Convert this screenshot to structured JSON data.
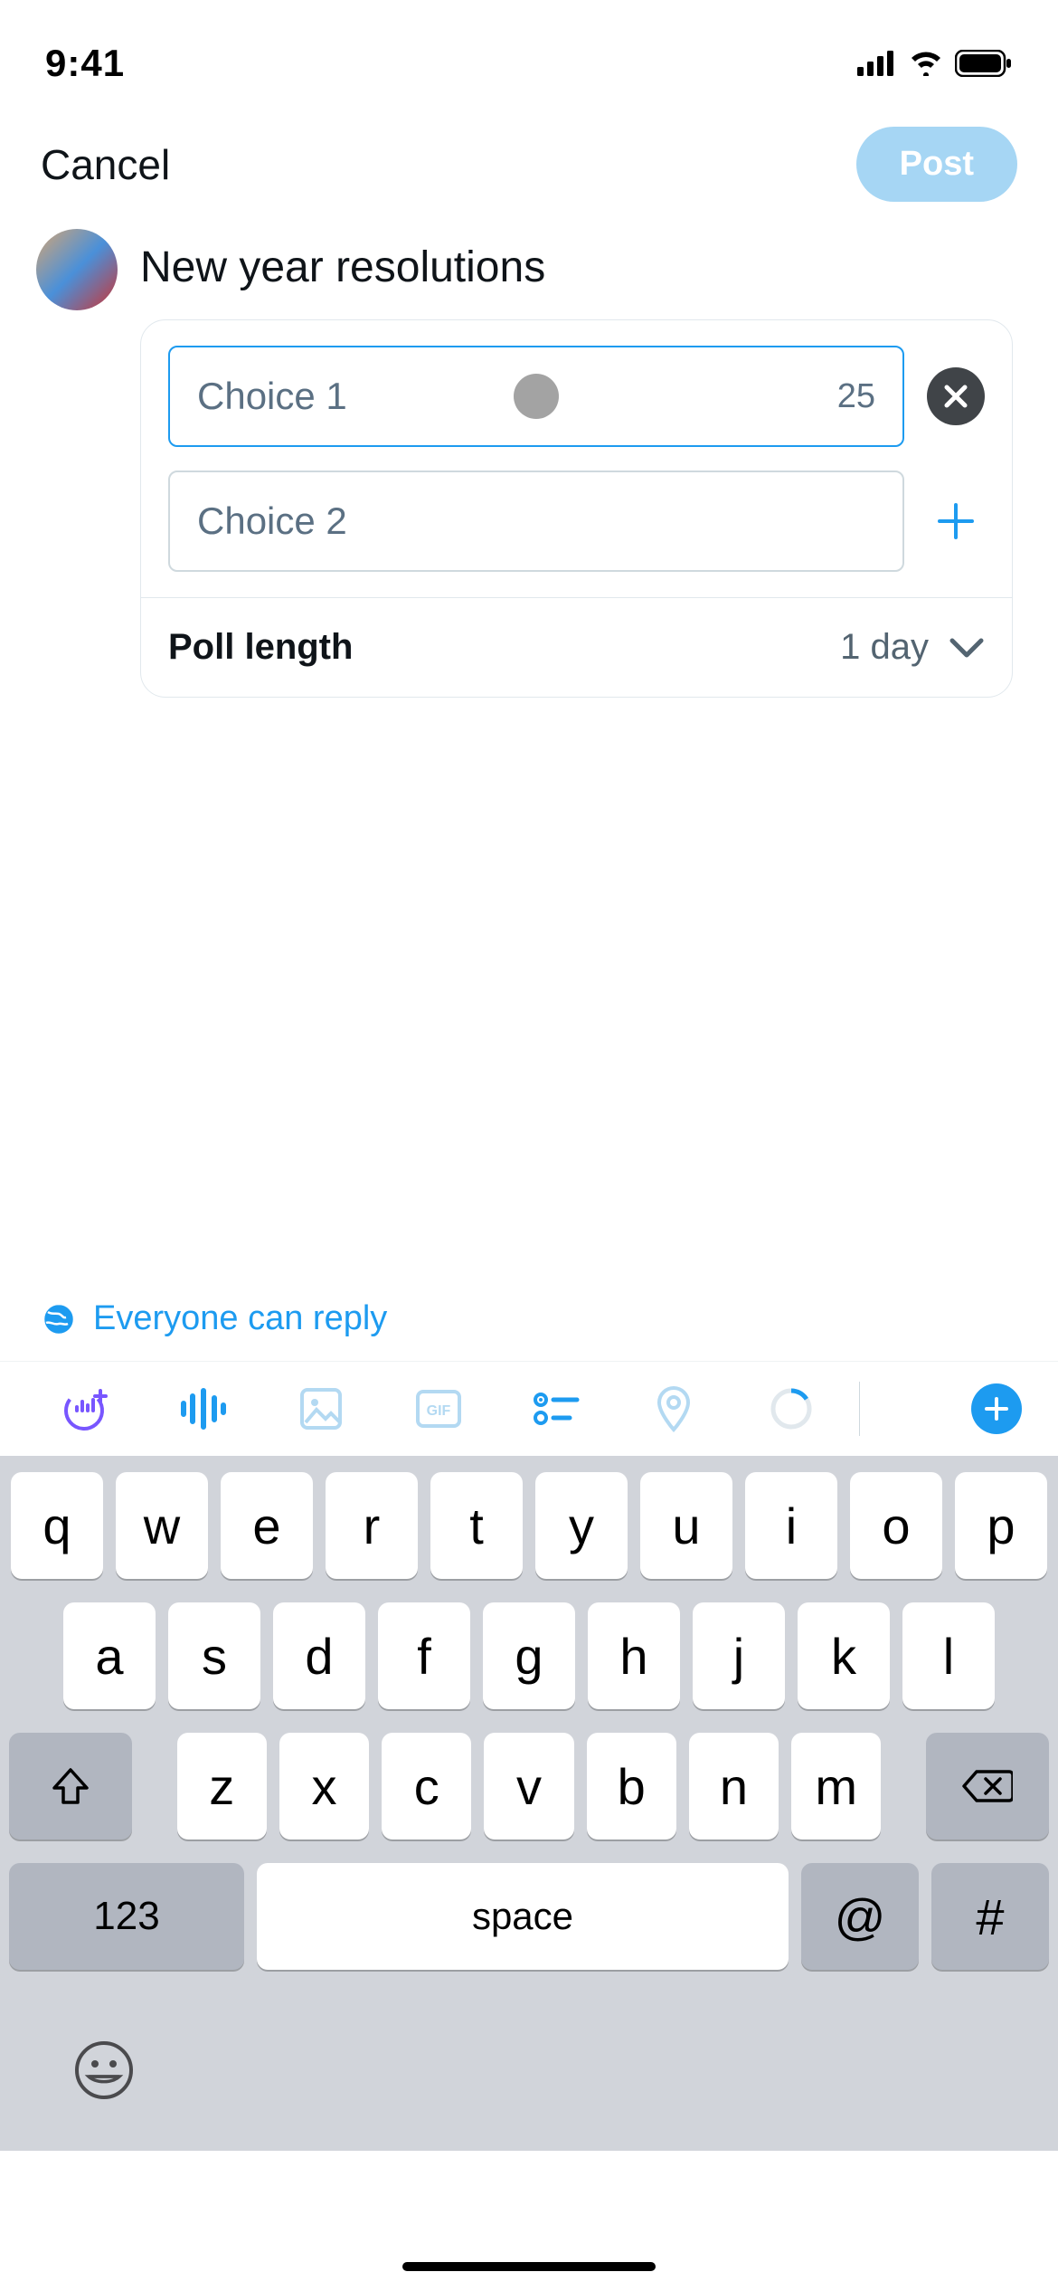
{
  "status": {
    "time": "9:41"
  },
  "nav": {
    "cancel": "Cancel",
    "post": "Post"
  },
  "compose": {
    "text": "New year resolutions"
  },
  "poll": {
    "choice1": {
      "placeholder": "Choice 1",
      "counter": "25"
    },
    "choice2": {
      "placeholder": "Choice 2"
    },
    "length_label": "Poll length",
    "length_value": "1 day"
  },
  "reply": {
    "label": "Everyone can reply"
  },
  "keyboard": {
    "row1": [
      "q",
      "w",
      "e",
      "r",
      "t",
      "y",
      "u",
      "i",
      "o",
      "p"
    ],
    "row2": [
      "a",
      "s",
      "d",
      "f",
      "g",
      "h",
      "j",
      "k",
      "l"
    ],
    "row3": [
      "z",
      "x",
      "c",
      "v",
      "b",
      "n",
      "m"
    ],
    "numbers": "123",
    "space": "space",
    "at": "@",
    "hash": "#"
  }
}
